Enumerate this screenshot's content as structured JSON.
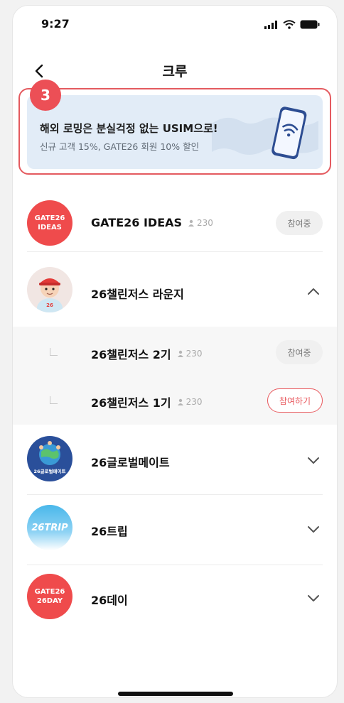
{
  "status_bar": {
    "time": "9:27"
  },
  "header": {
    "title": "크루"
  },
  "annotation": {
    "number": "3"
  },
  "banner": {
    "title": "해외 로밍은 분실걱정 없는 USIM으로!",
    "subtitle": "신규 고객 15%, GATE26 회원 10% 할인"
  },
  "crews": [
    {
      "name": "GATE26 IDEAS",
      "count": "230",
      "action": "참여중",
      "avatar_line1": "GATE26",
      "avatar_line2": "IDEAS"
    },
    {
      "name": "26챌린저스 라운지"
    },
    {
      "name": "26챌린저스 2기",
      "count": "230",
      "action": "참여중"
    },
    {
      "name": "26챌린저스 1기",
      "count": "230",
      "action": "참여하기"
    },
    {
      "name": "26글로벌메이트",
      "avatar_text": "26글로벌메이트"
    },
    {
      "name": "26트립",
      "avatar_text": "26TRIP"
    },
    {
      "name": "26데이",
      "avatar_line1": "GATE26",
      "avatar_line2": "26DAY"
    }
  ],
  "colors": {
    "accent": "#e8575c",
    "annotation": "#ec4f56",
    "banner_bg": "#e2ecf7"
  }
}
